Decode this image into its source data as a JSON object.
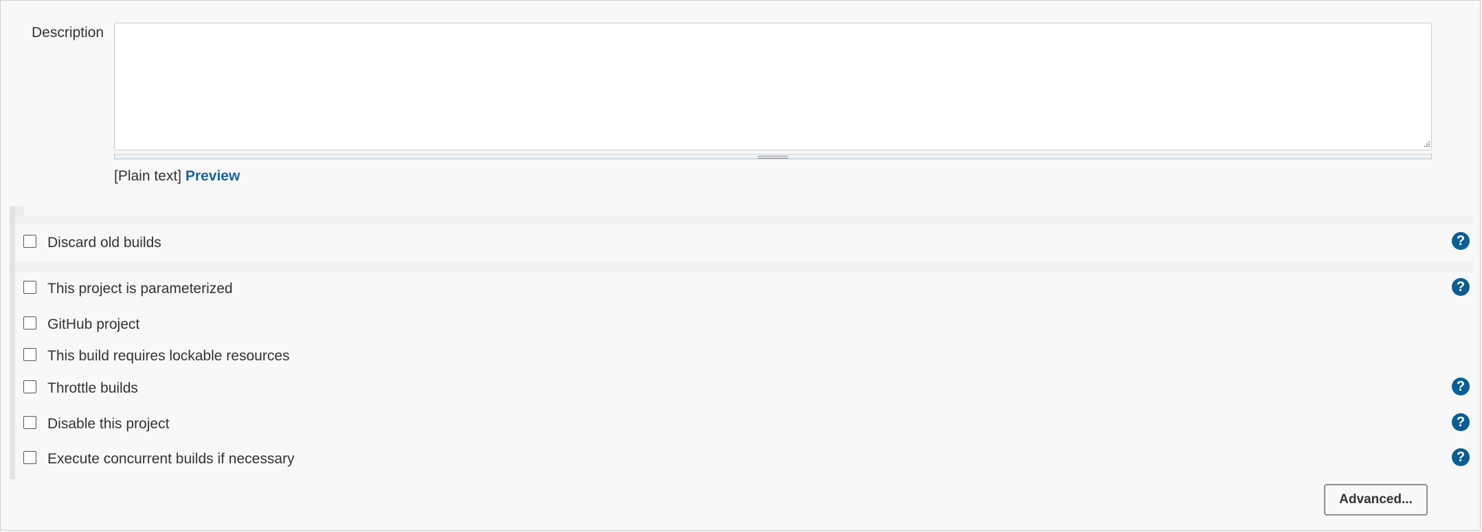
{
  "description": {
    "label": "Description",
    "value": "",
    "syntax_prefix": "[Plain text]",
    "preview_link": "Preview"
  },
  "options": [
    {
      "label": "Discard old builds",
      "checked": false,
      "help": true
    },
    {
      "label": "This project is parameterized",
      "checked": false,
      "help": true
    },
    {
      "label": "GitHub project",
      "checked": false,
      "help": false
    },
    {
      "label": "This build requires lockable resources",
      "checked": false,
      "help": false
    },
    {
      "label": "Throttle builds",
      "checked": false,
      "help": true
    },
    {
      "label": "Disable this project",
      "checked": false,
      "help": true
    },
    {
      "label": "Execute concurrent builds if necessary",
      "checked": false,
      "help": true
    }
  ],
  "help_glyph": "?",
  "advanced_button": "Advanced...",
  "colors": {
    "link": "#1565a6",
    "help_icon": "#0b5e93",
    "background": "#f8f8f8"
  },
  "icons": {
    "help": "help-circle-icon",
    "resize": "textarea-resize-handle-icon"
  }
}
